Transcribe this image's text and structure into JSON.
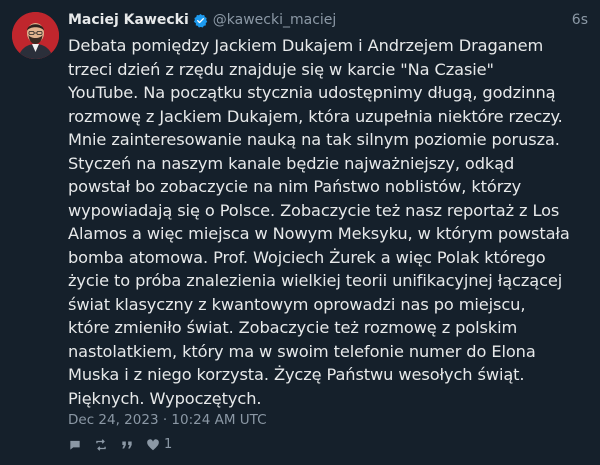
{
  "tweet": {
    "author_name": "Maciej Kawecki",
    "handle": "@kawecki_maciej",
    "time_ago": "6s",
    "text": "Debata pomiędzy Jackiem Dukajem i Andrzejem Draganem\ntrzeci dzień z rzędu znajduje się w karcie \"Na Czasie\"\nYouTube. Na początku stycznia udostępnimy długą, godzinną\nrozmowę z Jackiem Dukajem, która uzupełnia niektóre rzeczy.\nMnie zainteresowanie nauką na tak silnym poziomie porusza.\nStyczeń na naszym kanale będzie najważniejszy, odkąd\npowstał bo zobaczycie na nim Państwo noblistów, którzy\nwypowiadają się o Polsce. Zobaczycie też nasz reportaż z Los\nAlamos a więc miejsca w Nowym Meksyku, w którym powstała\nbomba atomowa. Prof. Wojciech Żurek a więc Polak którego\nżycie to próba znalezienia wielkiej teorii unifikacyjnej łączącej\nświat klasyczny z kwantowym oprowadzi nas po miejscu,\nktóre zmieniło świat. Zobaczycie też rozmowę z polskim\nnastolatkiem, który ma w swoim telefonie numer do Elona\nMuska i z niego korzysta. Życzę Państwu wesołych świąt.\nPięknych. Wypoczętych.",
    "date": "Dec 24, 2023 · 10:24 AM UTC",
    "like_count": "1"
  },
  "icons": {
    "verified": "verified-badge-icon",
    "reply": "comment-icon",
    "retweet": "retweet-icon",
    "quote": "quote-icon",
    "like": "heart-icon"
  },
  "colors": {
    "background": "#15202b",
    "text": "#e7e9ea",
    "muted": "#8b98a5",
    "verified": "#1d9bf0",
    "avatar_bg": "#c0262d"
  }
}
